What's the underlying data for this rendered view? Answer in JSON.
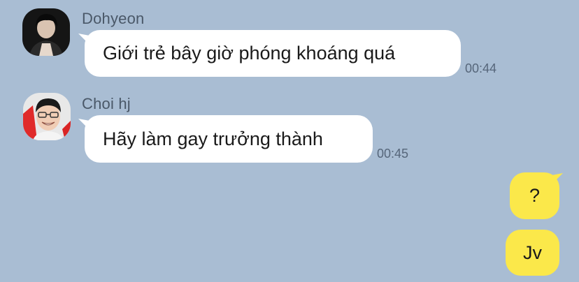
{
  "messages": [
    {
      "sender": "Dohyeon",
      "text": "Giới trẻ bây giờ phóng khoáng quá",
      "time": "00:44",
      "avatar_icon": "dark-portrait-photo"
    },
    {
      "sender": "Choi hj",
      "text": "Hãy làm gay trưởng thành",
      "time": "00:45",
      "avatar_icon": "smiling-glasses-portrait-photo"
    }
  ],
  "my_messages": [
    {
      "text": "?"
    },
    {
      "text": "Jv"
    }
  ],
  "colors": {
    "background": "#a9bdd3",
    "incoming_bubble": "#ffffff",
    "outgoing_bubble": "#fbe84a",
    "sender_name": "#4a5868",
    "timestamp": "#56667a"
  }
}
